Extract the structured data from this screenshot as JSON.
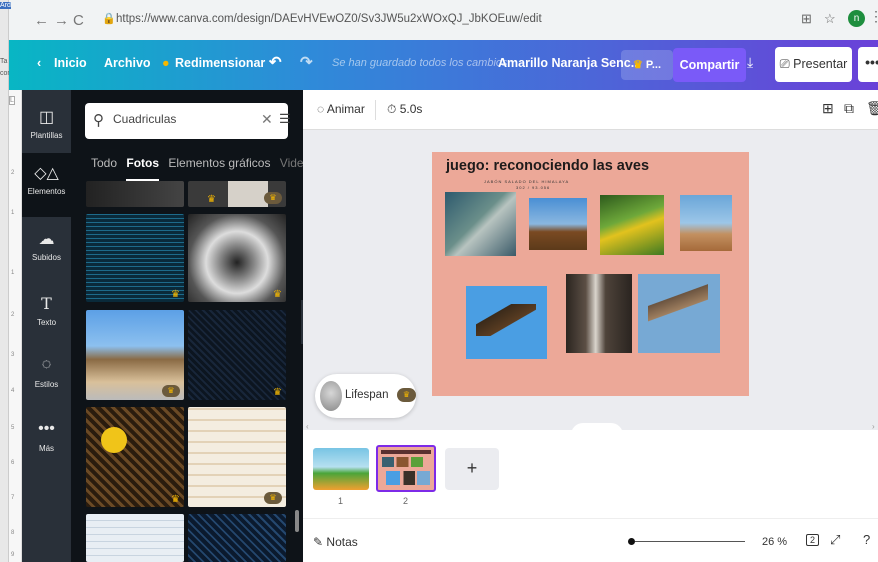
{
  "browser": {
    "url": "https://www.canva.com/design/DAEvHVEwOZ0/Sv3JW5u2xWOxQJ_JbKOEuw/edit",
    "left_tags": [
      "Ard",
      "Ta",
      "con"
    ],
    "profile_initial": "n"
  },
  "topbar": {
    "home_label": "Inicio",
    "file_label": "Archivo",
    "resize_label": "Redimensionar",
    "saved_status": "Se han guardado todos los cambios",
    "design_title": "Amarillo Naranja Senc...",
    "pro_label": "P...",
    "share_label": "Compartir",
    "present_label": "Presentar",
    "more_label": "•••"
  },
  "rail": {
    "items": [
      {
        "label": "Plantillas",
        "icon": "templates-icon"
      },
      {
        "label": "Elementos",
        "icon": "elements-icon"
      },
      {
        "label": "Subidos",
        "icon": "upload-icon"
      },
      {
        "label": "Texto",
        "icon": "text-icon"
      },
      {
        "label": "Estilos",
        "icon": "styles-icon"
      },
      {
        "label": "Más",
        "icon": "more-icon"
      }
    ]
  },
  "ruler": {
    "ticks": [
      "2",
      "1",
      "1",
      "2",
      "3",
      "4",
      "5",
      "6",
      "7",
      "8",
      "9"
    ]
  },
  "panel": {
    "search_value": "Cuadriculas",
    "tabs": [
      "Todo",
      "Fotos",
      "Elementos gráficos",
      "Videos"
    ],
    "active_tab": "Fotos"
  },
  "editor": {
    "animate_label": "Animar",
    "duration_label": "5.0s",
    "slide_title": "juego: reconociendo las aves",
    "slide_subtitle": "JABÓN SALADO DEL HIMALAYA",
    "slide_subtitle2": "302 / 93.056",
    "lifespan_label": "Lifespan",
    "page_numbers": [
      "1",
      "2"
    ],
    "add_page": "+",
    "notes_label": "Notas",
    "zoom_label": "26 %",
    "page_count": "2"
  }
}
